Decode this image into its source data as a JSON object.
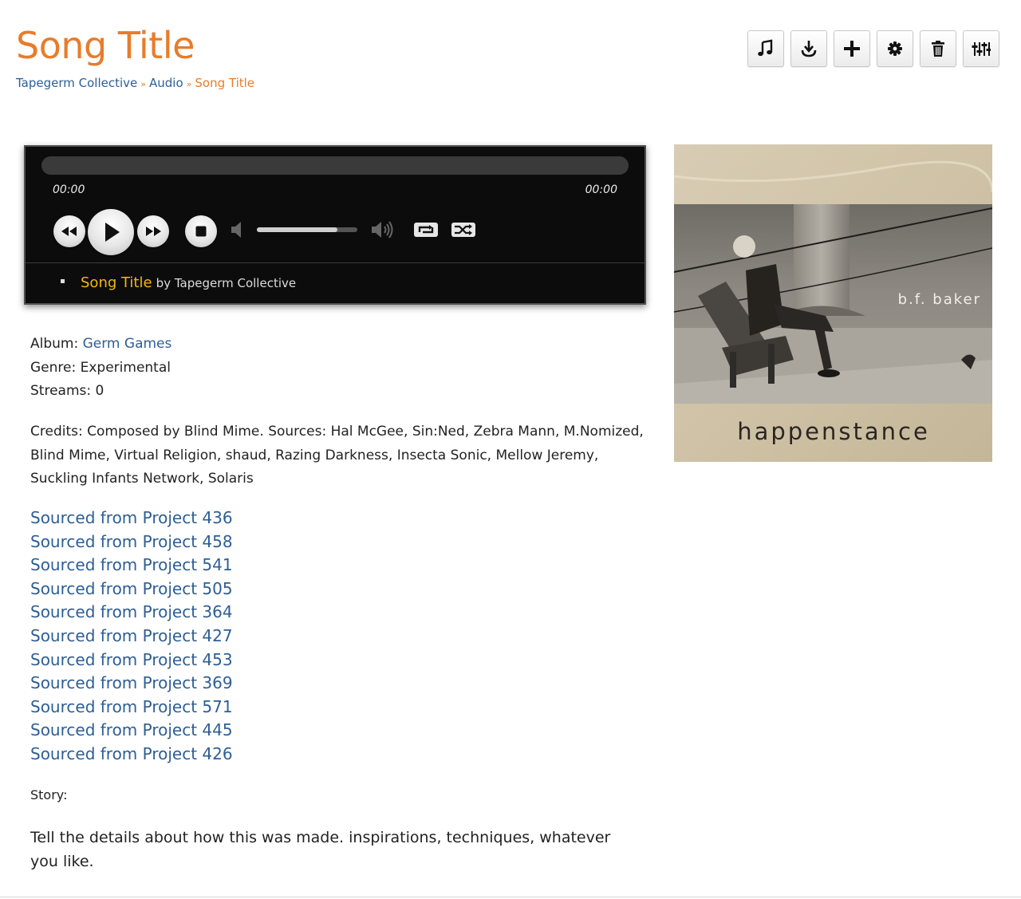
{
  "page": {
    "title": "Song Title"
  },
  "breadcrumb": {
    "items": [
      "Tapegerm Collective",
      "Audio"
    ],
    "current": "Song Title",
    "separator": "»"
  },
  "toolbar": {
    "buttons": [
      "music-note-icon",
      "download-icon",
      "plus-icon",
      "gear-icon",
      "trash-icon",
      "sliders-icon"
    ]
  },
  "player": {
    "time_current": "00:00",
    "time_total": "00:00",
    "volume_level": 0.8,
    "playlist": {
      "title": "Song Title",
      "by": "by Tapegerm Collective"
    }
  },
  "cover": {
    "artist": "b.f. baker",
    "album": "happenstance"
  },
  "meta": {
    "album_label": "Album: ",
    "album_value": "Germ Games",
    "genre_label": "Genre: ",
    "genre_value": "Experimental",
    "streams_label": "Streams: ",
    "streams_value": "0"
  },
  "credits": "Credits: Composed by Blind Mime. Sources: Hal McGee, Sin:Ned, Zebra Mann, M.Nomized, Blind Mime, Virtual Religion, shaud, Razing Darkness, Insecta Sonic, Mellow Jeremy, Suckling Infants Network, Solaris",
  "sources": [
    "Sourced from Project 436",
    "Sourced from Project 458",
    "Sourced from Project 541",
    "Sourced from Project 505",
    "Sourced from Project 364",
    "Sourced from Project 427",
    "Sourced from Project 453",
    "Sourced from Project 369",
    "Sourced from Project 571",
    "Sourced from Project 445",
    "Sourced from Project 426"
  ],
  "story": {
    "label": "Story:",
    "text": "Tell the details about how this was made. inspirations, techniques, whatever you like."
  },
  "colors": {
    "accent": "#e87c2a",
    "link": "#2d5e96",
    "playlist_title": "#f2b70f",
    "player_bg": "#0c0c0c"
  }
}
